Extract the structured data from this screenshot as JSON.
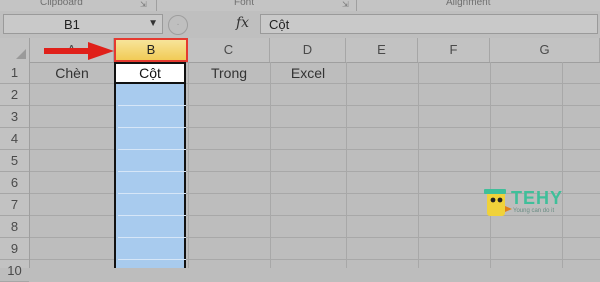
{
  "ribbon": {
    "groups": [
      "Clipboard",
      "Font",
      "Alignment"
    ]
  },
  "formula_bar": {
    "name_box": "B1",
    "fx_label": "fx",
    "content": "Cột"
  },
  "columns": [
    "A",
    "B",
    "C",
    "D",
    "E",
    "F",
    "G"
  ],
  "selected_column": "B",
  "rows": [
    "1",
    "2",
    "3",
    "4",
    "5",
    "6",
    "7",
    "8",
    "9",
    "10"
  ],
  "cells": {
    "A1": "Chèn",
    "B1": "Cột",
    "C1": "Trong",
    "D1": "Excel"
  },
  "watermark": {
    "brand": "TEHY",
    "tagline": "Young can do it"
  },
  "colors": {
    "selection": "#a8cbee",
    "header_highlight": "#f1cb56",
    "arrow": "#e0201a",
    "logo": "#3fbf9a"
  }
}
